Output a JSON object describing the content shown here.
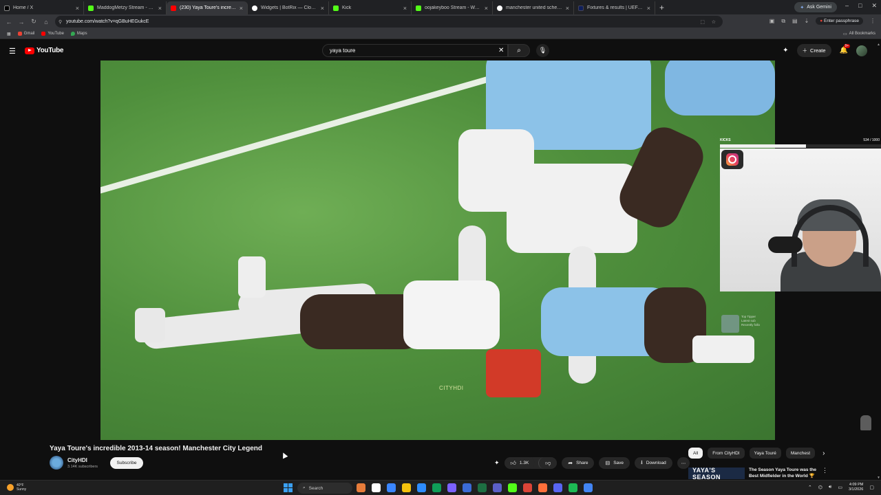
{
  "browser": {
    "tabs": [
      {
        "title": "Home / X",
        "color": "#000000"
      },
      {
        "title": "MaddogMetzy Stream - Watch",
        "color": "#53fc18"
      },
      {
        "title": "(230) Yaya Toure's incredib",
        "color": "#ff0000",
        "active": true
      },
      {
        "title": "Widgets | BotRix — Cloud Strea",
        "color": "#ffffff"
      },
      {
        "title": "Kick",
        "color": "#53fc18"
      },
      {
        "title": "oojakeyboo Stream - Watch Li",
        "color": "#53fc18"
      },
      {
        "title": "manchester united schedule - G",
        "color": "#ffffff"
      },
      {
        "title": "Fixtures & results | UEFA Champ",
        "color": "#0e1e5b"
      }
    ],
    "new_tab": "+",
    "gemini": "Ask Gemini",
    "window_controls": [
      "–",
      "□",
      "✕"
    ],
    "url": "youtube.com/watch?v=qGBuHEGukcE",
    "passphrase": "Enter passphrase",
    "bookmarks": [
      {
        "label": "Gmail",
        "color": "#ea4335"
      },
      {
        "label": "YouTube",
        "color": "#ff0000"
      },
      {
        "label": "Maps",
        "color": "#34a853"
      }
    ],
    "all_bookmarks": "All Bookmarks"
  },
  "youtube": {
    "logo": "YouTube",
    "search_query": "yaya toure",
    "create": "Create",
    "notification_count": "9+",
    "video": {
      "watermark": "CITYHDI",
      "title": "Yaya Toure's incredible 2013-14 season! Manchester City Legend",
      "channel": "CityHDI",
      "subscribers": "3.14K subscribers",
      "subscribe": "Subscribe",
      "likes": "1.3K",
      "share": "Share",
      "save": "Save",
      "download": "Download",
      "more": "⋯"
    },
    "overlay": {
      "kicks_label": "KICKS",
      "kicks_count": "534 / 1000",
      "kicks_progress": 0.534,
      "widget_lines": [
        "Top Tipper",
        "Latest sub",
        "Recently follo"
      ]
    },
    "chips": [
      "All",
      "From CityHDI",
      "Yaya Touré",
      "Manchest"
    ],
    "recommendation": {
      "thumb_text": "YAYA'S SEASON",
      "title": "The Season Yaya Toure was the Best Midfielder in the World 🏆"
    }
  },
  "taskbar": {
    "weather_temp": "40°F",
    "weather_cond": "Sunny",
    "search": "Search",
    "time": "4:09 PM",
    "date": "3/1/2026",
    "app_colors": [
      "#e77c3a",
      "#ffffff",
      "#3a86ff",
      "#f4c20d",
      "#2d8cff",
      "#0f9d58",
      "#7b61ff",
      "#3b6bd6",
      "#1d6f42",
      "#5b5fc7",
      "#53fc18",
      "#db4437",
      "#ff6f3a",
      "#5865f2",
      "#1db954",
      "#4285f4"
    ]
  }
}
